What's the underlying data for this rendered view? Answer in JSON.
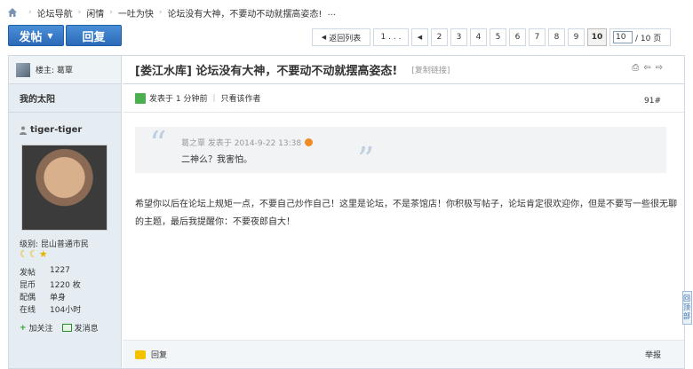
{
  "breadcrumb": {
    "items": [
      "论坛导航",
      "闲情",
      "一吐为快",
      "论坛没有大神，不要动不动就摆高姿态!",
      "..."
    ]
  },
  "toolbar": {
    "post_label": "发帖",
    "reply_label": "回复"
  },
  "pager": {
    "back_label": "返回列表",
    "first_label": "1 . . .",
    "pages": [
      "2",
      "3",
      "4",
      "5",
      "6",
      "7",
      "8",
      "9"
    ],
    "current": "10",
    "input_value": "10",
    "total_label": "/ 10 页"
  },
  "author_panel": {
    "host_label": "楼主: 葛覃",
    "section_title": "我的太阳",
    "username": "tiger-tiger",
    "level_label": "级别: 昆山普通市民",
    "stats": [
      {
        "key": "发帖",
        "value": "1227"
      },
      {
        "key": "昆币",
        "value": "1220 枚"
      },
      {
        "key": "配偶",
        "value": "单身"
      },
      {
        "key": "在线",
        "value": "104小时"
      }
    ],
    "follow_label": "加关注",
    "message_label": "发消息"
  },
  "post": {
    "title": "[娄江水库] 论坛没有大神，不要动不动就摆高姿态!",
    "copy_link": "[复制链接]",
    "posted_label": "发表于 1 分钟前",
    "author_only": "只看该作者",
    "floor": "91#",
    "quote_header": "葛之覃 发表于 2014-9-22 13:38",
    "quote_text": "二神么？我害怕。",
    "body": "希望你以后在论坛上规矩一点，不要自己炒作自己！这里是论坛，不是茶馆店！你积极写帖子，论坛肯定很欢迎你，但是不要写一些很无聊的主题，最后我提醒你：不要夜郎自大！",
    "reply_label": "回复",
    "report_label": "举报"
  },
  "back_to_top": "回顶部"
}
